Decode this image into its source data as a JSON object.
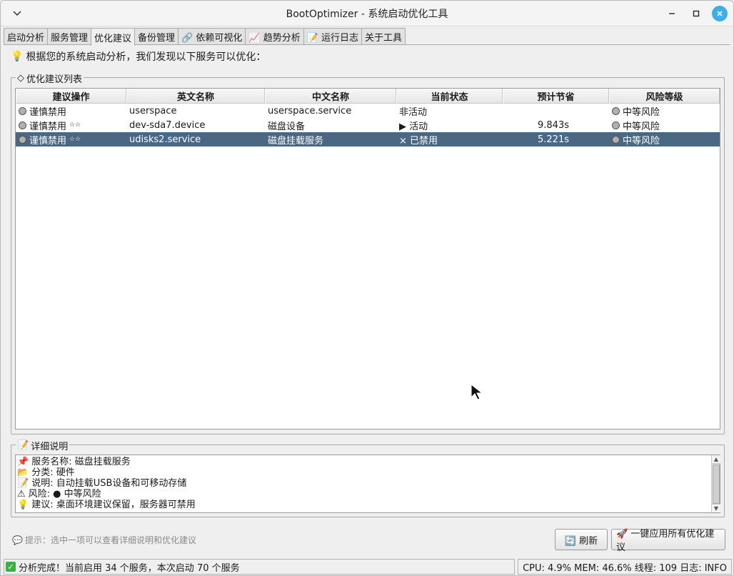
{
  "window": {
    "title": "BootOptimizer - 系统启动优化工具"
  },
  "tabs": [
    {
      "label": "启动分析"
    },
    {
      "label": "服务管理"
    },
    {
      "label": "优化建议"
    },
    {
      "label": "备份管理"
    },
    {
      "label": "🔗 依赖可视化"
    },
    {
      "label": "📈 趋势分析"
    },
    {
      "label": "📝 运行日志"
    },
    {
      "label": "关于工具"
    }
  ],
  "intro": {
    "icon": "💡",
    "text": "根据您的系统启动分析，我们发现以下服务可以优化："
  },
  "list_group": {
    "icon": "◇",
    "title": "优化建议列表"
  },
  "table": {
    "headers": [
      "建议操作",
      "英文名称",
      "中文名称",
      "当前状态",
      "预计节省",
      "风险等级"
    ],
    "rows": [
      {
        "action": "谨慎禁用",
        "stars": "",
        "en": "userspace",
        "cn": "userspace.service",
        "state": "非活动",
        "save": "",
        "risk": "中等风险"
      },
      {
        "action": "谨慎禁用",
        "stars": "☆☆",
        "en": "dev-sda7.device",
        "cn": "磁盘设备",
        "state": "▶ 活动",
        "save": "9.843s",
        "risk": "中等风险"
      },
      {
        "action": "谨慎禁用",
        "stars": "☆☆",
        "en": "udisks2.service",
        "cn": "磁盘挂载服务",
        "state": "× 已禁用",
        "save": "5.221s",
        "risk": "中等风险"
      }
    ]
  },
  "detail_group": {
    "icon": "📝",
    "title": "详细说明"
  },
  "detail": {
    "lines": [
      {
        "icon": "📌",
        "text": "服务名称: 磁盘挂载服务"
      },
      {
        "icon": "📂",
        "text": "分类: 硬件"
      },
      {
        "icon": "📝",
        "text": "说明: 自动挂载USB设备和可移动存储"
      },
      {
        "icon": "⚠",
        "text": "风险: ● 中等风险"
      },
      {
        "icon": "💡",
        "text": "建议: 桌面环境建议保留，服务器可禁用"
      }
    ]
  },
  "hint": {
    "icon": "💬",
    "text": "提示：选中一项可以查看详细说明和优化建议"
  },
  "buttons": {
    "refresh": "🔄 刷新",
    "apply": "🚀 一键应用所有优化建议"
  },
  "status": {
    "left": "分析完成！当前启用 34 个服务，本次启动 70 个服务",
    "right": "CPU: 4.9%  MEM: 46.6%  线程: 109  日志: INFO"
  }
}
